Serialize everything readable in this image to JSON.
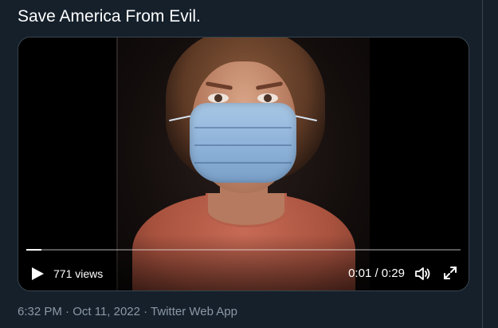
{
  "tweet": {
    "text": "Save America From Evil."
  },
  "video": {
    "views": "771 views",
    "time": "0:01 / 0:29",
    "progress_fraction": 0.034,
    "controls": {
      "play_icon": "play-icon",
      "volume_icon": "volume-icon",
      "fullscreen_icon": "fullscreen-icon"
    }
  },
  "meta": {
    "timestamp": "6:32 PM · Oct 11, 2022 · Twitter Web App"
  },
  "colors": {
    "background": "#15202b",
    "border": "#38444d",
    "text": "#ffffff",
    "secondary_text": "#8b98a5"
  }
}
